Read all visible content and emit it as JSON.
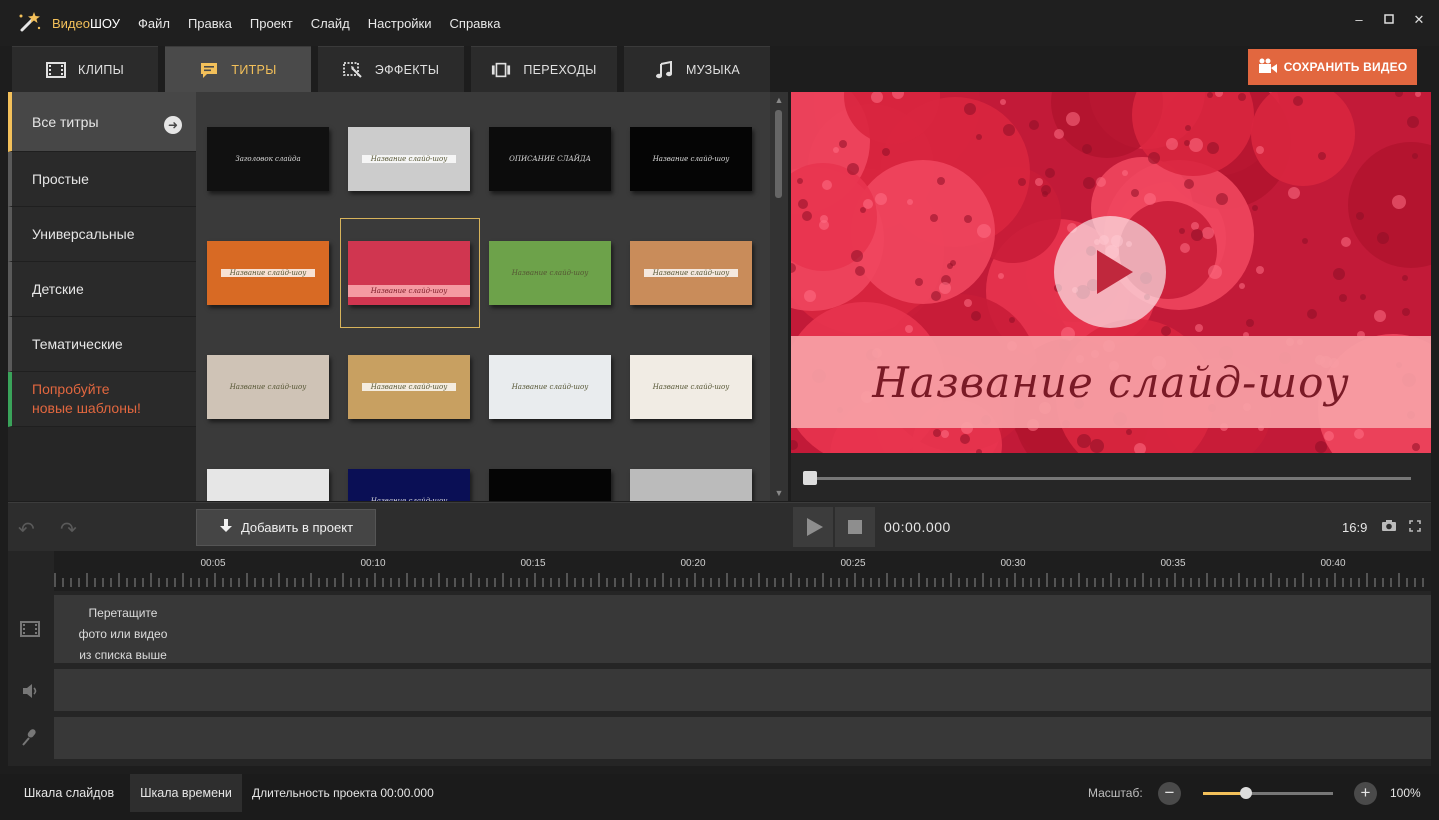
{
  "app": {
    "name_accent": "Видео",
    "name_rest": "ШОУ",
    "menu": [
      "Файл",
      "Правка",
      "Проект",
      "Слайд",
      "Настройки",
      "Справка"
    ]
  },
  "colors": {
    "accent": "#f3c05a",
    "save": "#e2673f",
    "promo": "#3aa35a"
  },
  "tabs": [
    {
      "label": "КЛИПЫ",
      "icon": "film-icon"
    },
    {
      "label": "ТИТРЫ",
      "icon": "speech-bubble-icon",
      "active": true
    },
    {
      "label": "ЭФФЕКТЫ",
      "icon": "effects-icon"
    },
    {
      "label": "ПЕРЕХОДЫ",
      "icon": "transitions-icon"
    },
    {
      "label": "МУЗЫКА",
      "icon": "music-note-icon"
    }
  ],
  "save_button": {
    "label": "СОХРАНИТЬ ВИДЕО",
    "icon": "camera-icon"
  },
  "categories": [
    {
      "label": "Все титры",
      "active": true
    },
    {
      "label": "Простые"
    },
    {
      "label": "Универсальные"
    },
    {
      "label": "Детские"
    },
    {
      "label": "Тематические"
    }
  ],
  "promo": {
    "line1": "Попробуйте",
    "line2": "новые шаблоны!"
  },
  "thumbnails": [
    {
      "caption": "Заголовок слайда",
      "bg": "#111"
    },
    {
      "caption": "Название слайд-шоу",
      "bg": "#ccc"
    },
    {
      "caption": "ОПИСАНИЕ СЛАЙДА",
      "bg": "#0c0c0c"
    },
    {
      "caption": "Название слайд-шоу",
      "bg": "#050505"
    },
    {
      "caption": "Название слайд-шоу",
      "bg": "#d86a24"
    },
    {
      "caption": "Название слайд-шоу",
      "bg": "#d03650",
      "selected": true
    },
    {
      "caption": "Название слайд-шоу",
      "bg": "#6da24a"
    },
    {
      "caption": "Название слайд-шоу",
      "bg": "#c98c5a"
    },
    {
      "caption": "Название слайд-шоу",
      "bg": "#cfc3b6"
    },
    {
      "caption": "Название слайд-шоу",
      "bg": "#c8a061"
    },
    {
      "caption": "Название слайд-шоу",
      "bg": "#e9ecee"
    },
    {
      "caption": "Название слайд-шоу",
      "bg": "#f1ece4"
    },
    {
      "caption": "",
      "bg": "#e6e6e6"
    },
    {
      "caption": "Название слайд-шоу",
      "bg": "#0a0f55"
    },
    {
      "caption": "",
      "bg": "#050505"
    },
    {
      "caption": "",
      "bg": "#bbb"
    }
  ],
  "preview": {
    "title": "Название слайд-шоу",
    "progress": 0
  },
  "toolbar": {
    "add_label": "Добавить в проект",
    "timecode": "00:00.000",
    "aspect": "16:9"
  },
  "timeline": {
    "labels": [
      "00:05",
      "00:10",
      "00:15",
      "00:20",
      "00:25",
      "00:30",
      "00:35",
      "00:40"
    ],
    "hint_line1": "Перетащите",
    "hint_line2": "фото или видео",
    "hint_line3": "из списка выше"
  },
  "statusbar": {
    "tab_slides": "Шкала слайдов",
    "tab_time": "Шкала времени",
    "duration": "Длительность проекта 00:00.000",
    "zoom_label": "Масштаб:",
    "zoom_value": "100%",
    "zoom_level": 0.33
  }
}
